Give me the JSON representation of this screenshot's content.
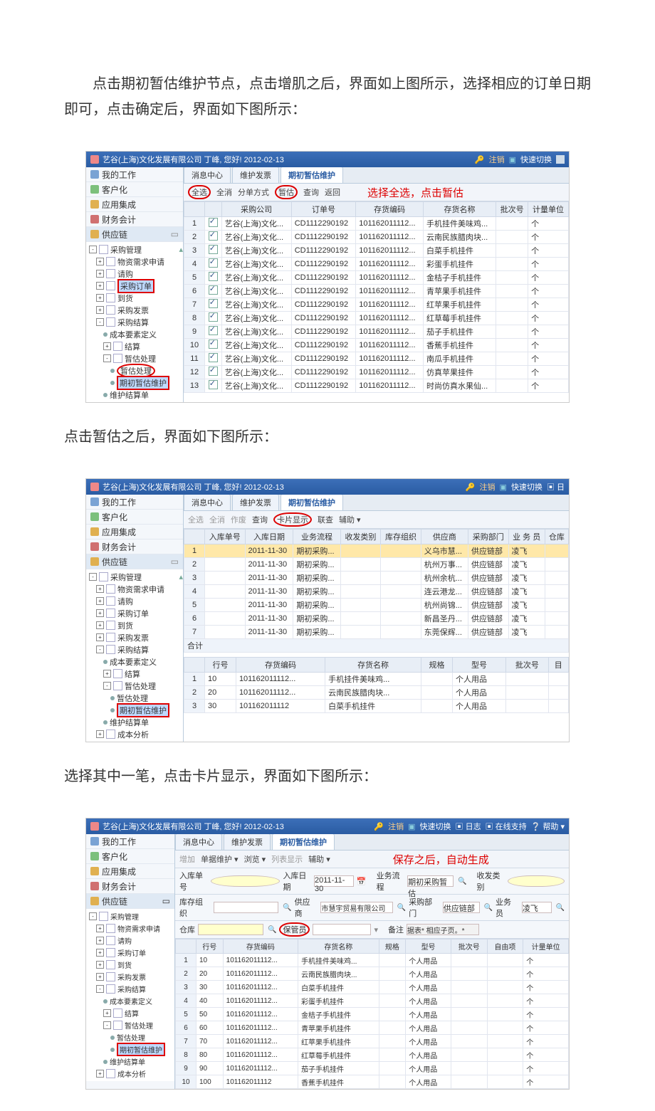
{
  "para1": "　　点击期初暂估维护节点，点击增肌之后，界面如上图所示，选择相应的订单日期即可，点击确定后，界面如下图所示：",
  "para2": "点击暂估之后，界面如下图所示：",
  "para3": "选择其中一笔，点击卡片显示，界面如下图所示：",
  "titlebar": {
    "title": "艺谷(上海)文化发展有限公司 丁峰, 您好! 2012-02-13",
    "logout": "注销",
    "switch": "快速切换",
    "log": "日志",
    "online": "在线支持",
    "help": "帮助"
  },
  "side": {
    "mywork": "我的工作",
    "client": "客户化",
    "integ": "应用集成",
    "fin": "财务会计",
    "supply": "供应链",
    "pm": "采购管理",
    "nodes": {
      "req": "物资需求申请",
      "apply": "请购",
      "order": "采购订单",
      "arrive": "到货",
      "invoice": "采购发票",
      "settle": "采购结算",
      "costdef": "成本要素定义",
      "jiesuan": "结算",
      "zghandle": "暂估处理",
      "zghandle2": "暂估处理",
      "qichu": "期初暂估维护",
      "weihujs": "维护结算单",
      "chengben": "成本分析"
    }
  },
  "tabs": {
    "msg": "消息中心",
    "invoice": "维护发票",
    "qichu": "期初暂估维护"
  },
  "tb1": {
    "allsel": "全选",
    "allcancel": "全消",
    "splitby": "分单方式",
    "zangu": "暂估",
    "query": "查询",
    "back": "返回",
    "annot": "选择全选，点击暂估"
  },
  "grid1": {
    "headers": [
      "",
      "",
      "采购公司",
      "订单号",
      "存货编码",
      "存货名称",
      "批次号",
      "计量单位"
    ],
    "company": "艺谷(上海)文化...",
    "order": "CD1112290192",
    "code": "101162011112...",
    "unit": "个",
    "names": [
      "手机挂件美味鸡...",
      "云南民族腊肉块...",
      "白菜手机挂件",
      "彩蛋手机挂件",
      "金桔子手机挂件",
      "青苹果手机挂件",
      "红苹果手机挂件",
      "红草莓手机挂件",
      "茄子手机挂件",
      "香蕉手机挂件",
      "南瓜手机挂件",
      "仿真苹果挂件",
      "时尚仿真水果仙..."
    ]
  },
  "tb2": {
    "allsel": "全选",
    "allcancel": "全消",
    "undo": "作废",
    "query": "查询",
    "card": "卡片显示",
    "lianc": "联查",
    "help": "辅助"
  },
  "grid2": {
    "headers": [
      "",
      "入库单号",
      "入库日期",
      "业务流程",
      "收发类别",
      "库存组织",
      "供应商",
      "采购部门",
      "业 务 员",
      "仓库"
    ],
    "date": "2011-11-30",
    "flow": "期初采购...",
    "dept": "供应链部",
    "person": "凌飞",
    "rows": [
      {
        "supplier": "义乌市慧..."
      },
      {
        "supplier": "杭州万事..."
      },
      {
        "supplier": "杭州余杭..."
      },
      {
        "supplier": "连云港龙..."
      },
      {
        "supplier": "杭州尚锦..."
      },
      {
        "supplier": "新昌圣丹..."
      },
      {
        "supplier": "东莞保辉..."
      }
    ],
    "sum": "合计"
  },
  "grid2b": {
    "headers": [
      "",
      "行号",
      "存货编码",
      "存货名称",
      "规格",
      "型号",
      "批次号",
      "目"
    ],
    "rows": [
      {
        "ln": "10",
        "code": "101162011112...",
        "name": "手机挂件美味鸡...",
        "type": "个人用品"
      },
      {
        "ln": "20",
        "code": "101162011112...",
        "name": "云南民族腊肉块...",
        "type": "个人用品"
      },
      {
        "ln": "30",
        "code": "101162011112",
        "name": "白菜手机挂件",
        "type": "个人用品"
      }
    ]
  },
  "tb3": {
    "add": "增加",
    "single": "单据维护",
    "browse": "浏览",
    "list": "列表显示",
    "help": "辅助"
  },
  "form3": {
    "annot": "保存之后，自动生成",
    "labels": {
      "rkno": "入库单号",
      "rkdate": "入库日期",
      "rkdate_v": "2011-11-30",
      "flow": "业务流程",
      "flow_v": "期初采购暂估",
      "rectype": "收发类别",
      "stockorg": "库存组织",
      "warehouse": "仓库",
      "supplier": "供应商",
      "supplier_v": "市慧宇贸易有限公司",
      "purdept": "采购部门",
      "purdept_v": "供应链部",
      "buyer": "业务员",
      "buyer_v": "凌飞",
      "keeper": "保管员",
      "remark": "备注",
      "remark_v": "据表* 相应子页。*"
    }
  },
  "grid3": {
    "headers": [
      "",
      "行号",
      "存货编码",
      "存货名称",
      "规格",
      "型号",
      "批次号",
      "自由项",
      "计量单位"
    ],
    "unit": "个",
    "type": "个人用品",
    "rows": [
      {
        "ln": "10",
        "code": "101162011112...",
        "name": "手机挂件美味鸡..."
      },
      {
        "ln": "20",
        "code": "101162011112...",
        "name": "云南民族腊肉块..."
      },
      {
        "ln": "30",
        "code": "101162011112...",
        "name": "白菜手机挂件"
      },
      {
        "ln": "40",
        "code": "101162011112...",
        "name": "彩蛋手机挂件"
      },
      {
        "ln": "50",
        "code": "101162011112...",
        "name": "金桔子手机挂件"
      },
      {
        "ln": "60",
        "code": "101162011112...",
        "name": "青苹果手机挂件"
      },
      {
        "ln": "70",
        "code": "101162011112...",
        "name": "红苹果手机挂件"
      },
      {
        "ln": "80",
        "code": "101162011112...",
        "name": "红草莓手机挂件"
      },
      {
        "ln": "90",
        "code": "101162011112...",
        "name": "茄子手机挂件"
      },
      {
        "ln": "100",
        "code": "101162011112",
        "name": "香蕉手机挂件"
      }
    ]
  }
}
